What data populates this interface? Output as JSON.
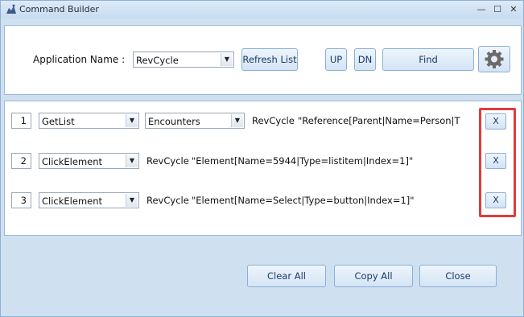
{
  "window": {
    "title": "Command Builder"
  },
  "titlebar": {
    "minimize": "—",
    "maximize": "☐",
    "close": "✕"
  },
  "header": {
    "app_label": "Application Name :",
    "app_value": "RevCycle",
    "refresh_label": "Refresh List",
    "up_label": "UP",
    "dn_label": "DN",
    "find_label": "Find"
  },
  "rows": [
    {
      "index": "1",
      "action": "GetList",
      "target": "Encounters",
      "app": "RevCycle",
      "expr": "\"Reference[Parent|Name=Person|T",
      "x": "X"
    },
    {
      "index": "2",
      "action": "ClickElement",
      "app": "RevCycle",
      "expr": "\"Element[Name=5944|Type=listitem|Index=1]\"",
      "x": "X"
    },
    {
      "index": "3",
      "action": "ClickElement",
      "app": "RevCycle",
      "expr": "\"Element[Name=Select|Type=button|Index=1]\"",
      "x": "X"
    }
  ],
  "footer": {
    "clear_all": "Clear All",
    "copy_all": "Copy All",
    "close": "Close"
  },
  "colors": {
    "highlight": "#e23b3b",
    "accent": "#8eaed3"
  }
}
